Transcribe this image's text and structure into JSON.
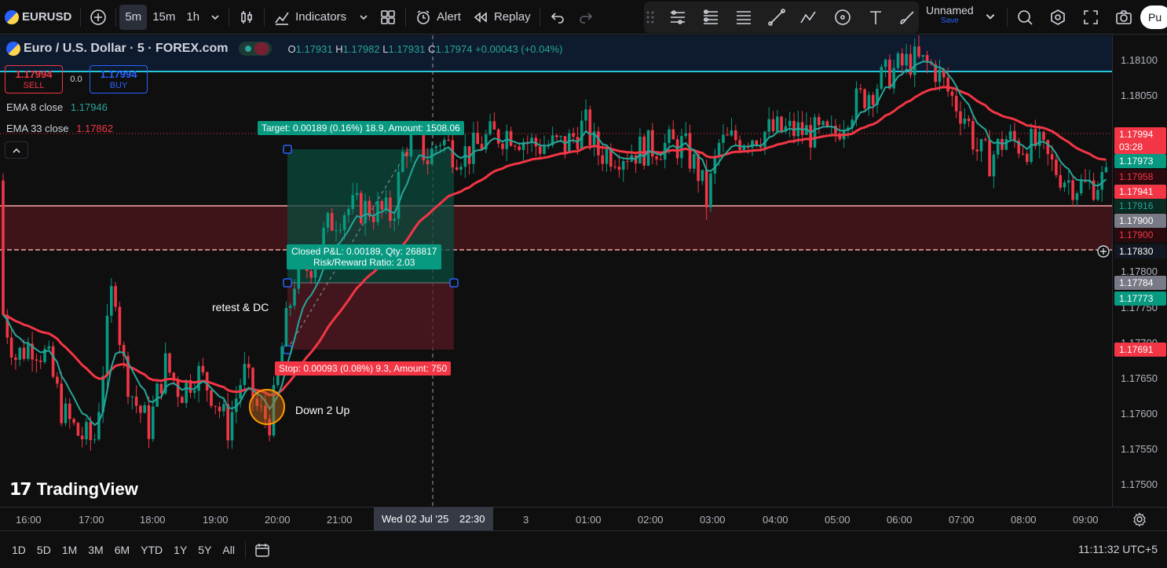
{
  "toolbar": {
    "symbol": "EURUSD",
    "intervals": [
      "5m",
      "15m",
      "1h"
    ],
    "active_interval": "5m",
    "indicators_label": "Indicators",
    "alert_label": "Alert",
    "replay_label": "Replay",
    "layout_name": "Unnamed",
    "save_label": "Save",
    "publish_label": "Pu"
  },
  "legend": {
    "title": "Euro / U.S. Dollar · 5 · FOREX.com",
    "open_k": "O",
    "open": "1.17931",
    "high_k": "H",
    "high": "1.17982",
    "low_k": "L",
    "low": "1.17931",
    "close_k": "C",
    "close": "1.17974",
    "change": "+0.00043 (+0.04%)",
    "sell_price": "1.17994",
    "sell_label": "SELL",
    "spread": "0.0",
    "buy_price": "1.17994",
    "buy_label": "BUY",
    "ema8_label": "EMA 8 close",
    "ema8_value": "1.17946",
    "ema33_label": "EMA 33 close",
    "ema33_value": "1.17862"
  },
  "position": {
    "target_label": "Target: 0.00189 (0.16%) 18.9, Amount: 1508.06",
    "pnl_line1": "Closed P&L: 0.00189, Qty: 268817",
    "pnl_line2": "Risk/Reward Ratio: 2.03",
    "stop_label": "Stop: 0.00093 (0.08%) 9.3, Amount: 750"
  },
  "annotations": {
    "retest": "retest & DC",
    "down2up": "Down 2 Up"
  },
  "watermark": "TradingView",
  "price_axis": {
    "ticks": [
      "1.18100",
      "1.18050",
      "1.17800",
      "1.17750",
      "1.17700",
      "1.17650",
      "1.17600",
      "1.17550",
      "1.17500"
    ],
    "labels": [
      {
        "text": "1.17994",
        "color": "#f23645"
      },
      {
        "text": "03:28",
        "color": "#f23645"
      },
      {
        "text": "1.17973",
        "color": "#089981"
      },
      {
        "text": "1.17958",
        "color": "#2a0a0e"
      },
      {
        "text": "1.17941",
        "color": "#f23645"
      },
      {
        "text": "1.17916",
        "color": "#0a2a22"
      },
      {
        "text": "1.17900",
        "color": "#787b86"
      },
      {
        "text": "1.17900",
        "color": "#2a0a0e"
      },
      {
        "text": "1.17830",
        "color": "#131722"
      },
      {
        "text": "1.17784",
        "color": "#787b86"
      },
      {
        "text": "1.17773",
        "color": "#089981"
      },
      {
        "text": "1.17691",
        "color": "#f23645"
      }
    ]
  },
  "time_axis": {
    "ticks": [
      "16:00",
      "17:00",
      "18:00",
      "19:00",
      "20:00",
      "21:00",
      "3",
      "01:00",
      "02:00",
      "03:00",
      "04:00",
      "05:00",
      "06:00",
      "07:00",
      "08:00",
      "09:00"
    ],
    "crosshair_date": "Wed 02 Jul '25",
    "crosshair_time": "22:30"
  },
  "bottombar": {
    "ranges": [
      "1D",
      "5D",
      "1M",
      "3M",
      "6M",
      "YTD",
      "1Y",
      "5Y",
      "All"
    ],
    "clock": "11:11:32 UTC+5"
  },
  "colors": {
    "up": "#089981",
    "down": "#f23645",
    "ema8": "#26a69a",
    "ema33": "#f23645",
    "resistance": "#26c6da",
    "zone": "#4a1a1e"
  }
}
